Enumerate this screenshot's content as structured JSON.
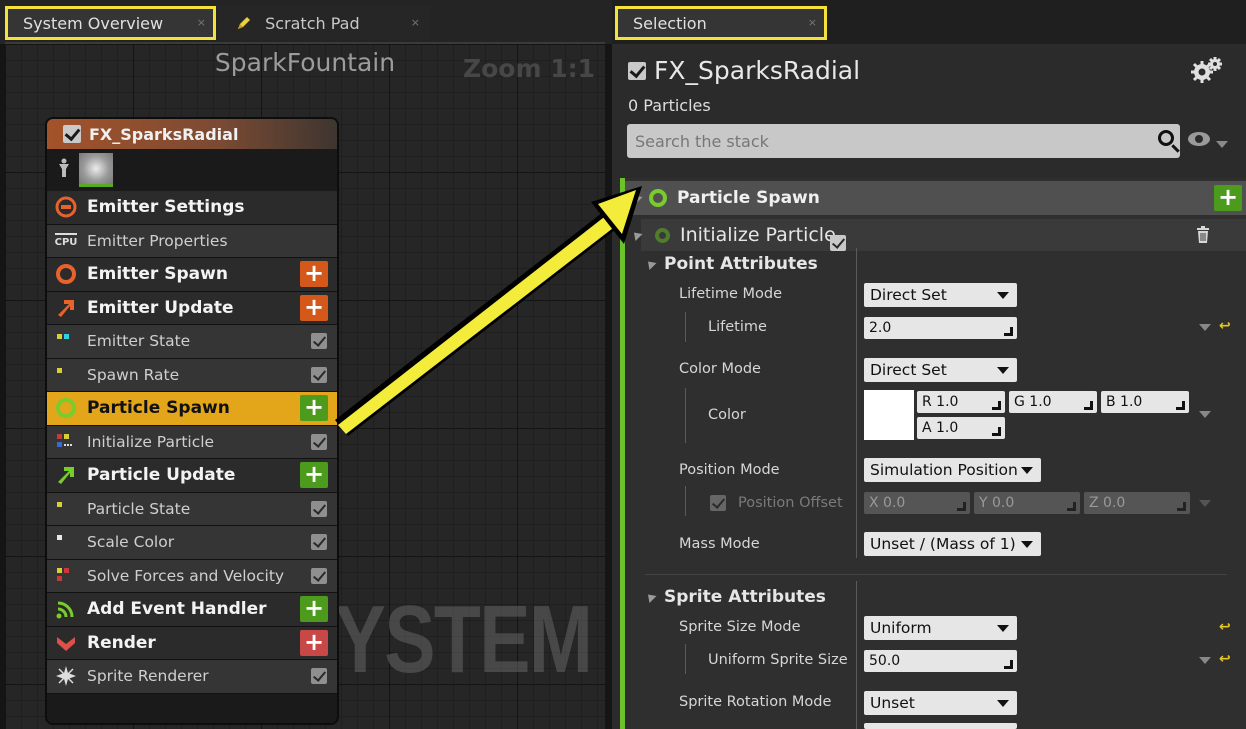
{
  "tabs": {
    "system_overview": "System Overview",
    "scratch_pad": "Scratch Pad",
    "selection": "Selection",
    "close": "×"
  },
  "graph": {
    "title": "SparkFountain",
    "zoom": "Zoom 1:1",
    "watermark": "SYSTEM",
    "node": {
      "title": "FX_SparksRadial",
      "rows": [
        {
          "label": "Emitter Settings",
          "kind": "big",
          "icon": "emitter-settings-icon"
        },
        {
          "label": "Emitter Properties",
          "kind": "small",
          "icon": "cpu-icon"
        },
        {
          "label": "Emitter Spawn",
          "kind": "big",
          "icon": "emitter-spawn-icon",
          "add": "+"
        },
        {
          "label": "Emitter Update",
          "kind": "big",
          "icon": "emitter-update-icon",
          "add": "+"
        },
        {
          "label": "Emitter State",
          "kind": "small",
          "icon": "module-icon"
        },
        {
          "label": "Spawn Rate",
          "kind": "small",
          "icon": "module-icon"
        },
        {
          "label": "Particle Spawn",
          "kind": "big",
          "icon": "particle-spawn-icon",
          "add": "+"
        },
        {
          "label": "Initialize Particle",
          "kind": "small",
          "icon": "module-icon"
        },
        {
          "label": "Particle Update",
          "kind": "big",
          "icon": "particle-update-icon",
          "add": "+"
        },
        {
          "label": "Particle State",
          "kind": "small",
          "icon": "module-icon"
        },
        {
          "label": "Scale Color",
          "kind": "small",
          "icon": "module-icon"
        },
        {
          "label": "Solve Forces and Velocity",
          "kind": "small",
          "icon": "module-icon"
        },
        {
          "label": "Add Event Handler",
          "kind": "big",
          "icon": "event-handler-icon",
          "add": "+"
        },
        {
          "label": "Render",
          "kind": "big",
          "icon": "render-icon",
          "add": "+"
        },
        {
          "label": "Sprite Renderer",
          "kind": "small",
          "icon": "sprite-renderer-icon"
        }
      ],
      "cpu_badge": "CPU"
    }
  },
  "selection": {
    "title": "FX_SparksRadial",
    "particles": "0 Particles",
    "search_placeholder": "Search the stack",
    "stack": {
      "group": "Particle Spawn",
      "add": "+",
      "module": "Initialize Particle",
      "point_attributes": "Point Attributes",
      "lifetime_mode_label": "Lifetime Mode",
      "lifetime_mode": "Direct Set",
      "lifetime_label": "Lifetime",
      "lifetime": "2.0",
      "color_mode_label": "Color Mode",
      "color_mode": "Direct Set",
      "color_label": "Color",
      "color": {
        "r": "R 1.0",
        "g": "G 1.0",
        "b": "B 1.0",
        "a": "A 1.0",
        "swatch": "#ffffff"
      },
      "position_mode_label": "Position Mode",
      "position_mode": "Simulation Position",
      "position_offset_label": "Position Offset",
      "position_offset": {
        "x": "X 0.0",
        "y": "Y 0.0",
        "z": "Z 0.0"
      },
      "mass_mode_label": "Mass Mode",
      "mass_mode": "Unset / (Mass of 1)",
      "sprite_attributes": "Sprite Attributes",
      "sprite_size_mode_label": "Sprite Size Mode",
      "sprite_size_mode": "Uniform",
      "uniform_sprite_size_label": "Uniform Sprite Size",
      "uniform_sprite_size": "50.0",
      "sprite_rotation_mode_label": "Sprite Rotation Mode",
      "sprite_rotation_mode": "Unset",
      "revert": "↩"
    }
  },
  "colors": {
    "highlight": "#f4e23a",
    "selected_row": "#e3a51a",
    "green": "#4c9b1c",
    "orange": "#d4581a"
  }
}
